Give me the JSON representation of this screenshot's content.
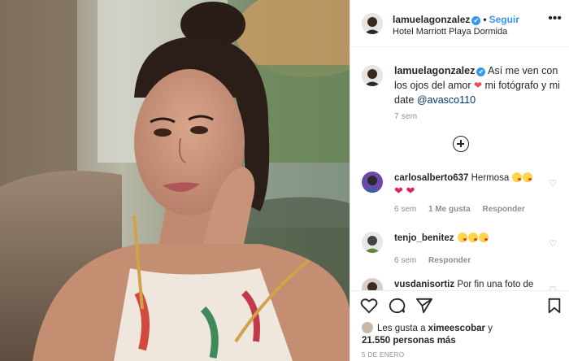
{
  "header": {
    "username": "lamuelagonzalez",
    "verified_mark": "✔",
    "dot": "•",
    "follow_label": "Seguir",
    "location": "Hotel Marriott Playa Dormida",
    "more_icon": "more-dots-icon"
  },
  "caption": {
    "username": "lamuelagonzalez",
    "text_part1": "Así me ven con los ojos del amor",
    "heart": "❤",
    "text_part2": "mi fotógrafo y mi date",
    "mention": "@avasco110",
    "time": "7 sem"
  },
  "comments": [
    {
      "username": "carlosalberto637",
      "text": "Hermosa",
      "hearts": "❤ ❤",
      "time": "6 sem",
      "likes": "1 Me gusta",
      "reply": "Responder"
    },
    {
      "username": "tenjo_benitez",
      "text": "",
      "time": "6 sem",
      "reply": "Responder"
    },
    {
      "username": "vusdanisortiz",
      "text": "Por fin una foto de"
    }
  ],
  "likes": {
    "prefix": "Les gusta a",
    "first_user": "ximeescobar",
    "connector": "y",
    "others": "21.550 personas más"
  },
  "date": "5 DE ENERO",
  "colors": {
    "accent": "#3897f0",
    "heart": "#ed4956",
    "muted": "#8e8e8e",
    "border": "#efefef"
  }
}
